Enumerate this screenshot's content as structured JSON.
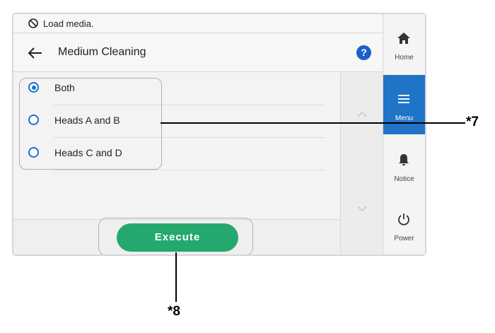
{
  "status": {
    "message": "Load media.",
    "icon": "no-entry-icon"
  },
  "header": {
    "title": "Medium Cleaning",
    "help_label": "?"
  },
  "options": [
    {
      "label": "Both",
      "selected": true
    },
    {
      "label": "Heads A and B",
      "selected": false
    },
    {
      "label": "Heads C and D",
      "selected": false
    }
  ],
  "footer": {
    "execute_label": "Execute"
  },
  "sidebar": {
    "items": [
      {
        "label": "Home",
        "icon": "home-icon",
        "active": false
      },
      {
        "label": "Menu",
        "icon": "menu-icon",
        "active": true
      },
      {
        "label": "Notice",
        "icon": "bell-icon",
        "active": false
      },
      {
        "label": "Power",
        "icon": "power-icon",
        "active": false
      }
    ]
  },
  "callouts": {
    "c7": "*7",
    "c8": "*8"
  },
  "colors": {
    "accent": "#1f74c8",
    "execute": "#25a86e",
    "radio": "#1a6fd1"
  }
}
